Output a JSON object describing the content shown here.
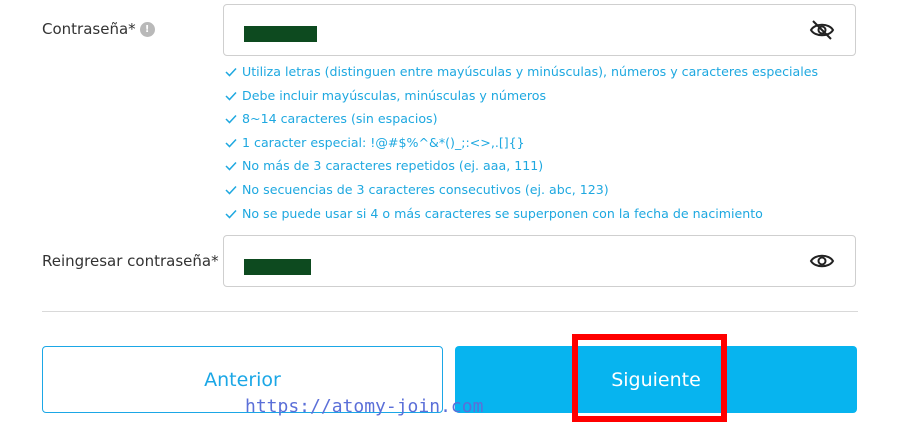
{
  "password": {
    "label": "Contraseña*",
    "info_icon": "info-icon",
    "toggle_icon": "eye-slash-icon"
  },
  "rules": [
    "Utiliza letras (distinguen entre mayúsculas y minúsculas), números y caracteres especiales",
    "Debe incluir mayúsculas, minúsculas y números",
    "8~14 caracteres (sin espacios)",
    "1 caracter especial: !@#$%^&*()_;:<>,.[]{}",
    "No más de 3 caracteres repetidos (ej. aaa, 111)",
    "No secuencias de 3 caracteres consecutivos (ej. abc, 123)",
    "No se puede usar si 4 o más caracteres se superponen con la fecha de nacimiento"
  ],
  "confirm": {
    "label": "Reingresar contraseña*",
    "toggle_icon": "eye-icon"
  },
  "buttons": {
    "prev": "Anterior",
    "next": "Siguiente"
  },
  "watermark": "https://atomy-join.com",
  "colors": {
    "accent": "#07b4ef",
    "rule_text": "#1ea8e0",
    "highlight": "#ff0000",
    "mask": "#0d4a1f"
  }
}
